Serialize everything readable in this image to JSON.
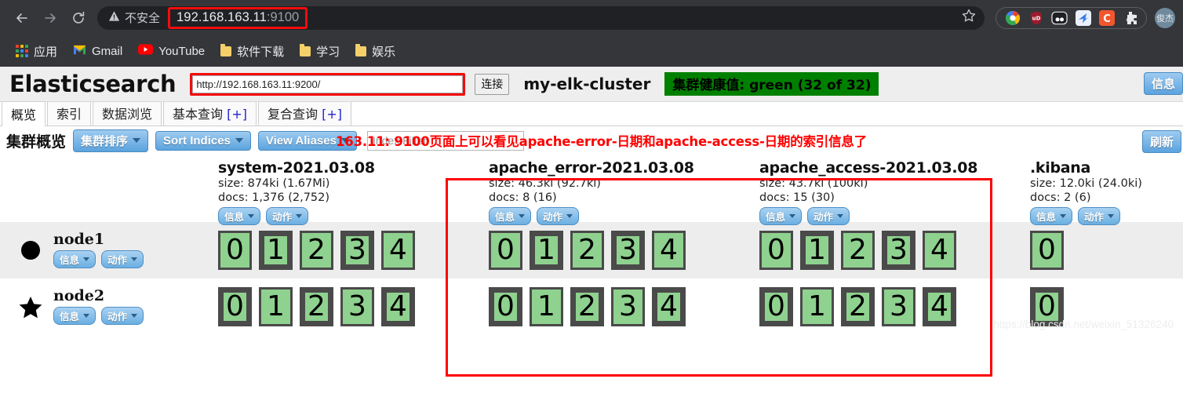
{
  "browser": {
    "back_icon": "back-arrow-icon",
    "forward_icon": "forward-arrow-icon",
    "reload_icon": "reload-icon",
    "security_label": "不安全",
    "url_main": "192.168.163.11",
    "url_port": ":9100",
    "star_icon": "bookmark-star-icon",
    "extensions": [
      {
        "name": "chrome-colors-extension",
        "glyph": "",
        "color": "#ffffff"
      },
      {
        "name": "ublock-shield-extension",
        "glyph": "uD",
        "color": "#9c1a2b"
      },
      {
        "name": "pocket-extension",
        "glyph": "oo",
        "color": "#ffffff"
      },
      {
        "name": "bird-extension",
        "glyph": "",
        "color": "#e9eefc"
      },
      {
        "name": "c-extension",
        "glyph": "C",
        "color": "#f2562f"
      },
      {
        "name": "puzzle-extensions-icon",
        "glyph": "",
        "color": "#ffffff"
      }
    ],
    "avatar_label": "俊杰",
    "bookmarks": [
      {
        "label": "应用",
        "icon": "apps-grid-icon"
      },
      {
        "label": "Gmail",
        "icon": "gmail-icon"
      },
      {
        "label": "YouTube",
        "icon": "youtube-icon"
      },
      {
        "label": "软件下载",
        "icon": "folder-icon"
      },
      {
        "label": "学习",
        "icon": "folder-icon"
      },
      {
        "label": "娱乐",
        "icon": "folder-icon"
      }
    ]
  },
  "app": {
    "brand": "Elasticsearch",
    "host_value": "http://192.168.163.11:9200/",
    "host_placeholder": "",
    "connect_label": "连接",
    "cluster_name": "my-elk-cluster",
    "health_label": "集群健康值: green (32 of 32)",
    "header_right_button": "信息",
    "tabs": [
      {
        "label": "概览",
        "active": true
      },
      {
        "label": "索引",
        "active": false
      },
      {
        "label": "数据浏览",
        "active": false
      },
      {
        "label": "基本查询 ",
        "plus": "[+]",
        "active": false
      },
      {
        "label": "复合查询 ",
        "plus": "[+]",
        "active": false
      }
    ],
    "subbar": {
      "title": "集群概览",
      "sort_cluster_label": "集群排序",
      "sort_indices_label": "Sort Indices",
      "view_aliases_label": "View Aliases",
      "filter_placeholder": "Index Filter",
      "filter_value": "",
      "refresh_label": "刷新"
    },
    "annotation": "163.11: 9100页面上可以看见apache-error-日期和apache-access-日期的索引信息了",
    "info_label": "信息",
    "action_label": "动作",
    "watermark": "https://blog.csdn.net/weixin_51326240"
  },
  "indices": [
    {
      "name": "system-2021.03.08",
      "size": "size: 874ki (1.67Mi)",
      "docs": "docs: 1,376 (2,752)",
      "highlighted": false
    },
    {
      "name": "apache_error-2021.03.08",
      "size": "size: 46.3ki (92.7ki)",
      "docs": "docs: 8 (16)",
      "highlighted": true
    },
    {
      "name": "apache_access-2021.03.08",
      "size": "size: 43.7ki (100ki)",
      "docs": "docs: 15 (30)",
      "highlighted": true
    },
    {
      "name": ".kibana",
      "size": "size: 12.0ki (24.0ki)",
      "docs": "docs: 2 (6)",
      "highlighted": false
    }
  ],
  "nodes": [
    {
      "name": "node1",
      "marker": "circle-master-icon",
      "shards": [
        [
          "0",
          "1",
          "2",
          "3",
          "4"
        ],
        [
          "0",
          "1",
          "2",
          "3",
          "4"
        ],
        [
          "0",
          "1",
          "2",
          "3",
          "4"
        ],
        [
          "0"
        ]
      ],
      "shard_styles": [
        [
          "thin",
          "thick",
          "thin",
          "thick",
          "thin"
        ],
        [
          "thin",
          "thick",
          "thin",
          "thick",
          "thin"
        ],
        [
          "thin",
          "thick",
          "thin",
          "thick",
          "thin"
        ],
        [
          "thin"
        ]
      ]
    },
    {
      "name": "node2",
      "marker": "star-master-icon",
      "shards": [
        [
          "0",
          "1",
          "2",
          "3",
          "4"
        ],
        [
          "0",
          "1",
          "2",
          "3",
          "4"
        ],
        [
          "0",
          "1",
          "2",
          "3",
          "4"
        ],
        [
          "0"
        ]
      ],
      "shard_styles": [
        [
          "thick",
          "thin",
          "thick",
          "thin",
          "thick"
        ],
        [
          "thick",
          "thin",
          "thick",
          "thin",
          "thick"
        ],
        [
          "thick",
          "thin",
          "thick",
          "thin",
          "thick"
        ],
        [
          "thick"
        ]
      ]
    }
  ],
  "colors": {
    "health_green": "#008000",
    "shard_green": "#8fd18f",
    "annotation_red": "#ff0000",
    "chrome_dark": "#35363a"
  }
}
